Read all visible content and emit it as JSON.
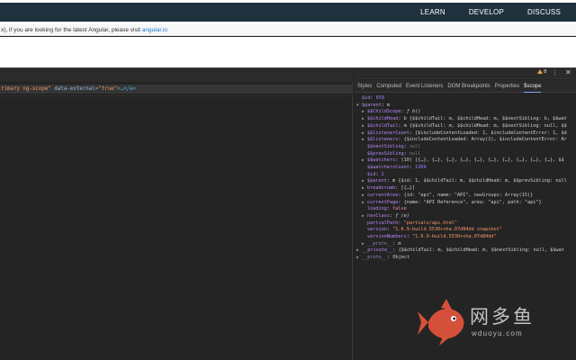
{
  "site": {
    "nav": [
      "LEARN",
      "DEVELOP",
      "DISCUSS"
    ],
    "notice_text": "x), if you are looking for the latest Angular, please visit ",
    "notice_link": "angular.io"
  },
  "elements": {
    "line": {
      "attr_tail": "rimary ng-scope\"",
      "attr_name": "data-external",
      "attr_eq": "=",
      "attr_value": "\"true\"",
      "tag_close": ">…</a>"
    }
  },
  "sidebar": {
    "warnings_count": "8",
    "tabs": [
      "Styles",
      "Computed",
      "Event Listeners",
      "DOM Breakpoints",
      "Properties",
      "$scope"
    ],
    "active_tab": "$scope"
  },
  "scope_tree": [
    {
      "arrow": "",
      "indent": 0,
      "k": "$id",
      "v": "658",
      "vt": "num"
    },
    {
      "arrow": "▼",
      "indent": 0,
      "k": "$parent",
      "v": "m",
      "vt": "p"
    },
    {
      "arrow": "▶",
      "indent": 1,
      "k": "$$ChildScope",
      "v": "ƒ b()",
      "vt": "fn"
    },
    {
      "arrow": "▶",
      "indent": 1,
      "k": "$$childHead",
      "v": "b {$$childTail: m, $$childHead: m, $$nextSibling: b, $$wat",
      "vt": "p"
    },
    {
      "arrow": "▶",
      "indent": 1,
      "k": "$$childTail",
      "v": "m {$$childTail: m, $$childHead: m, $$nextSibling: null, $$",
      "vt": "p"
    },
    {
      "arrow": "▶",
      "indent": 1,
      "k": "$$listenerCount",
      "v": "{$includeContentLoaded: 1, $includeContentError: 1, $d",
      "vt": "p"
    },
    {
      "arrow": "▶",
      "indent": 1,
      "k": "$$listeners",
      "v": "{$includeContentLoaded: Array(1), $includeContentError: Ar",
      "vt": "p"
    },
    {
      "arrow": "",
      "indent": 1,
      "k": "$$nextSibling",
      "v": "null",
      "vt": "nul"
    },
    {
      "arrow": "",
      "indent": 1,
      "k": "$$prevSibling",
      "v": "null",
      "vt": "nul"
    },
    {
      "arrow": "▶",
      "indent": 1,
      "k": "$$watchers",
      "v": "(10) [{…}, {…}, {…}, {…}, {…}, {…}, {…}, {…}, {…}, {…}, $$",
      "vt": "p"
    },
    {
      "arrow": "",
      "indent": 1,
      "k": "$$watchersCount",
      "v": "1369",
      "vt": "num"
    },
    {
      "arrow": "",
      "indent": 1,
      "k": "$id",
      "v": "2",
      "vt": "num"
    },
    {
      "arrow": "▶",
      "indent": 1,
      "k": "$parent",
      "v": "m {$id: 1, $$childTail: m, $$childHead: m, $$prevSibling: null",
      "vt": "p"
    },
    {
      "arrow": "▶",
      "indent": 1,
      "k": "breadcrumb",
      "v": "[{…}]",
      "vt": "p"
    },
    {
      "arrow": "▶",
      "indent": 1,
      "k": "currentArea",
      "v": "{id: \"api\", name: \"API\", navGroups: Array(15)}",
      "vt": "p"
    },
    {
      "arrow": "▶",
      "indent": 1,
      "k": "currentPage",
      "v": "{name: \"API Reference\", area: \"api\", path: \"api\"}",
      "vt": "p"
    },
    {
      "arrow": "",
      "indent": 1,
      "k": "loading",
      "v": "false",
      "vt": "kw"
    },
    {
      "arrow": "▶",
      "indent": 1,
      "k": "navClass",
      "v": "ƒ (e)",
      "vt": "fn"
    },
    {
      "arrow": "",
      "indent": 1,
      "k": "partialPath",
      "v": "\"partials/api.html\"",
      "vt": "str"
    },
    {
      "arrow": "",
      "indent": 1,
      "k": "version",
      "v": "\"1.6.9-build.5530+sha.07d84dd snapshot\"",
      "vt": "str"
    },
    {
      "arrow": "",
      "indent": 1,
      "k": "versionNumbers",
      "v": "\"1.6.9-build.5530+sha.07d84dd\"",
      "vt": "str"
    },
    {
      "arrow": "▶",
      "indent": 1,
      "k": "__proto__",
      "v": "m",
      "vt": "p",
      "dim": true
    },
    {
      "arrow": "▶",
      "indent": 0,
      "k": "__private__",
      "v": "{$$childTail: m, $$childHead: m, $$nextSibling: null, $$wat",
      "vt": "p"
    },
    {
      "arrow": "▶",
      "indent": 0,
      "k": "__proto__",
      "v": "Object",
      "vt": "p",
      "dim": true
    }
  ],
  "watermark": {
    "name": "网多鱼",
    "domain": "wduoyu.com"
  }
}
